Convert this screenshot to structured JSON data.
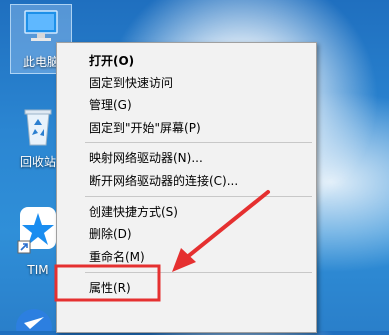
{
  "desktop": {
    "icons": [
      {
        "label": "此电脑"
      },
      {
        "label": "回收站"
      },
      {
        "label": "TIM"
      }
    ]
  },
  "context_menu": {
    "items": [
      {
        "label": "打开(O)"
      },
      {
        "label": "固定到快速访问"
      },
      {
        "label": "管理(G)"
      },
      {
        "label": "固定到\"开始\"屏幕(P)"
      },
      {
        "label": "映射网络驱动器(N)..."
      },
      {
        "label": "断开网络驱动器的连接(C)..."
      },
      {
        "label": "创建快捷方式(S)"
      },
      {
        "label": "删除(D)"
      },
      {
        "label": "重命名(M)"
      },
      {
        "label": "属性(R)"
      }
    ]
  },
  "annotation": {
    "color": "#e53030"
  }
}
